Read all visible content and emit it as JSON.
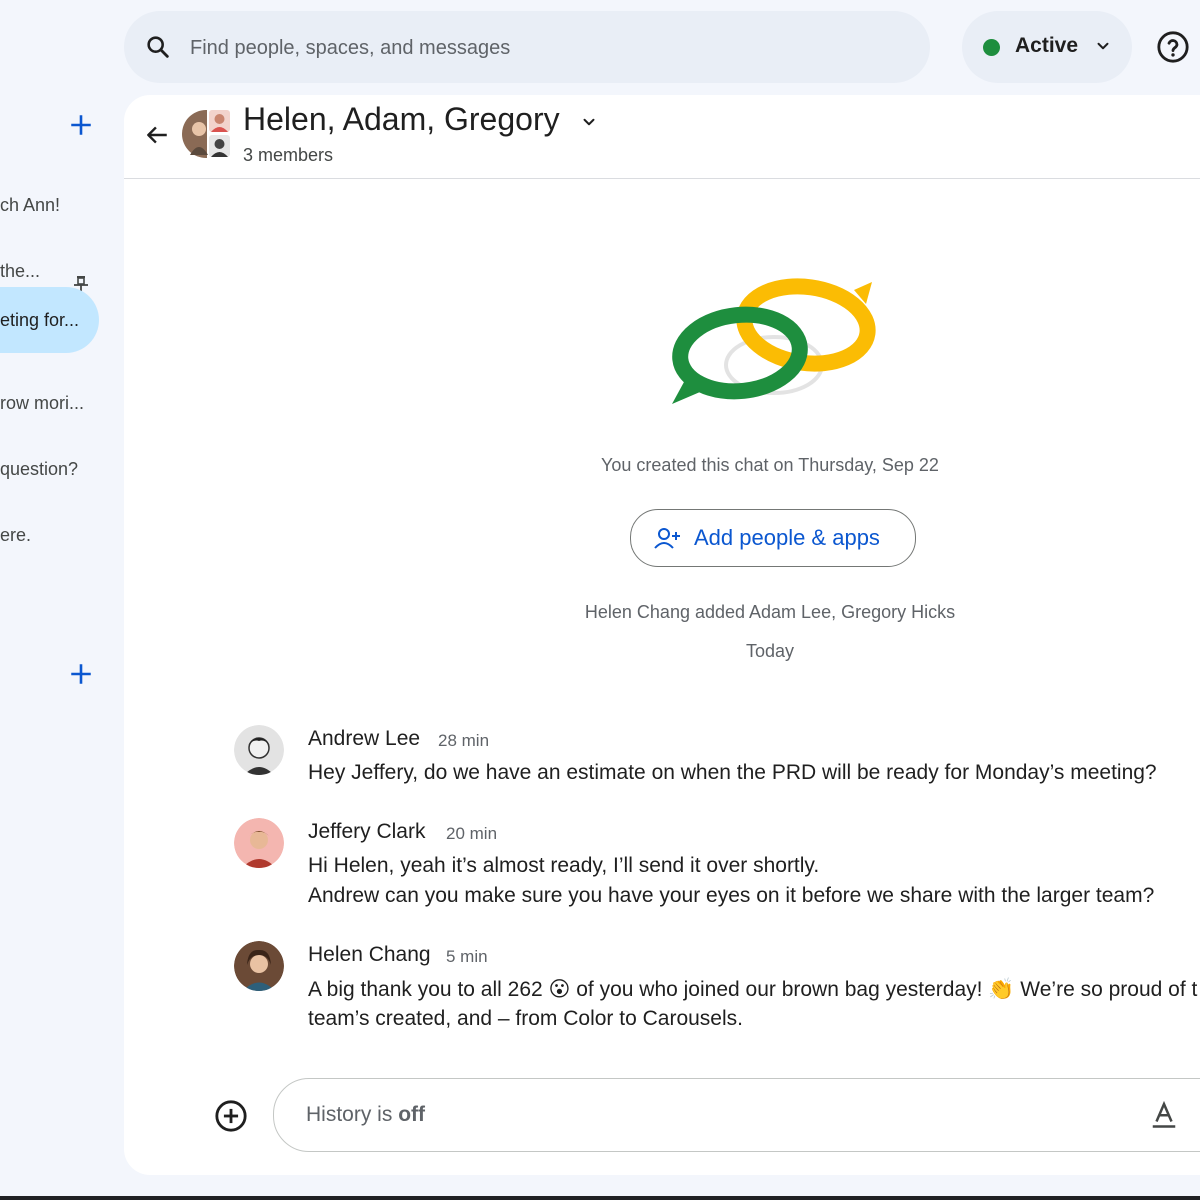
{
  "search": {
    "placeholder": "Find people, spaces, and messages"
  },
  "status": {
    "label": "Active",
    "color": "#1e8e3e"
  },
  "sidebar": {
    "items": [
      {
        "label": "ch Ann!"
      },
      {
        "label": " the..."
      },
      {
        "label": "eting for..."
      },
      {
        "label": "row mori..."
      },
      {
        "label": "question?"
      },
      {
        "label": "ere."
      }
    ]
  },
  "header": {
    "title": "Helen, Adam, Gregory",
    "subtitle": "3 members"
  },
  "intro": {
    "created_text": "You created this chat on Thursday, Sep 22",
    "add_button_label": "Add people & apps",
    "added_text": "Helen Chang added Adam Lee, Gregory Hicks",
    "day_divider": "Today"
  },
  "messages": [
    {
      "name": "Andrew Lee",
      "time": "28 min",
      "lines": [
        "Hey Jeffery, do we have an estimate on when the PRD will be ready for Monday’s meeting?"
      ]
    },
    {
      "name": "Jeffery Clark",
      "time": "20 min",
      "lines": [
        "Hi Helen, yeah it’s almost ready, I’ll send it over shortly.",
        "Andrew can you make sure you have your eyes on it before we share with the larger team?"
      ]
    },
    {
      "name": "Helen Chang",
      "time": "5 min",
      "lines": [
        "A big thank you to all 262 😮 of you who joined our brown bag yesterday! 👏 We’re so proud of t",
        "team’s created, and – from Color to Carousels."
      ]
    }
  ],
  "composer": {
    "history_prefix": "History is ",
    "history_state": "off"
  },
  "colors": {
    "accent": "#0b57d0",
    "selected": "#c2e7ff",
    "logo_green": "#1e8e3e",
    "logo_yellow": "#fbbc04"
  }
}
